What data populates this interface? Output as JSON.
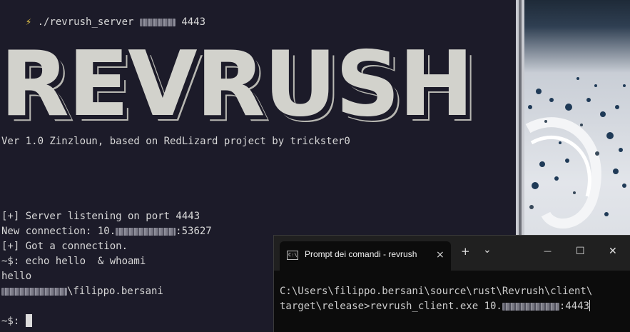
{
  "left_terminal": {
    "prompt_symbol": "⚡",
    "command_prefix": "./revrush_server",
    "command_suffix": "4443",
    "banner": "REVRUSH",
    "version_line": "Ver 1.0 Zinzloun, based on RedLizard project by trickster0",
    "listening": "[+] Server listening on port 4443",
    "new_conn_prefix": "New connection: 10.",
    "new_conn_suffix": ":53627",
    "got_conn": "[+] Got a connection.",
    "echo_cmd": "~$: echo hello  & whoami",
    "hello": "hello",
    "whoami_suffix": "\\filippo.bersani",
    "final_prompt": "~$: "
  },
  "cmd_window": {
    "tab_title": "Prompt dei comandi - revrush",
    "tab_close": "×",
    "new_tab": "+",
    "dropdown": "⌄",
    "minimize": "—",
    "maximize": "☐",
    "close": "✕",
    "line1": "C:\\Users\\filippo.bersani\\source\\rust\\Revrush\\client\\",
    "line2_prefix": "target\\release>revrush_client.exe 10.",
    "line2_suffix": ":4443"
  },
  "colors": {
    "terminal_bg": "#1c1b29",
    "terminal_fg": "#d8d8d8",
    "cmd_bg": "#0c0c0c",
    "cmd_titlebar": "#202020"
  }
}
